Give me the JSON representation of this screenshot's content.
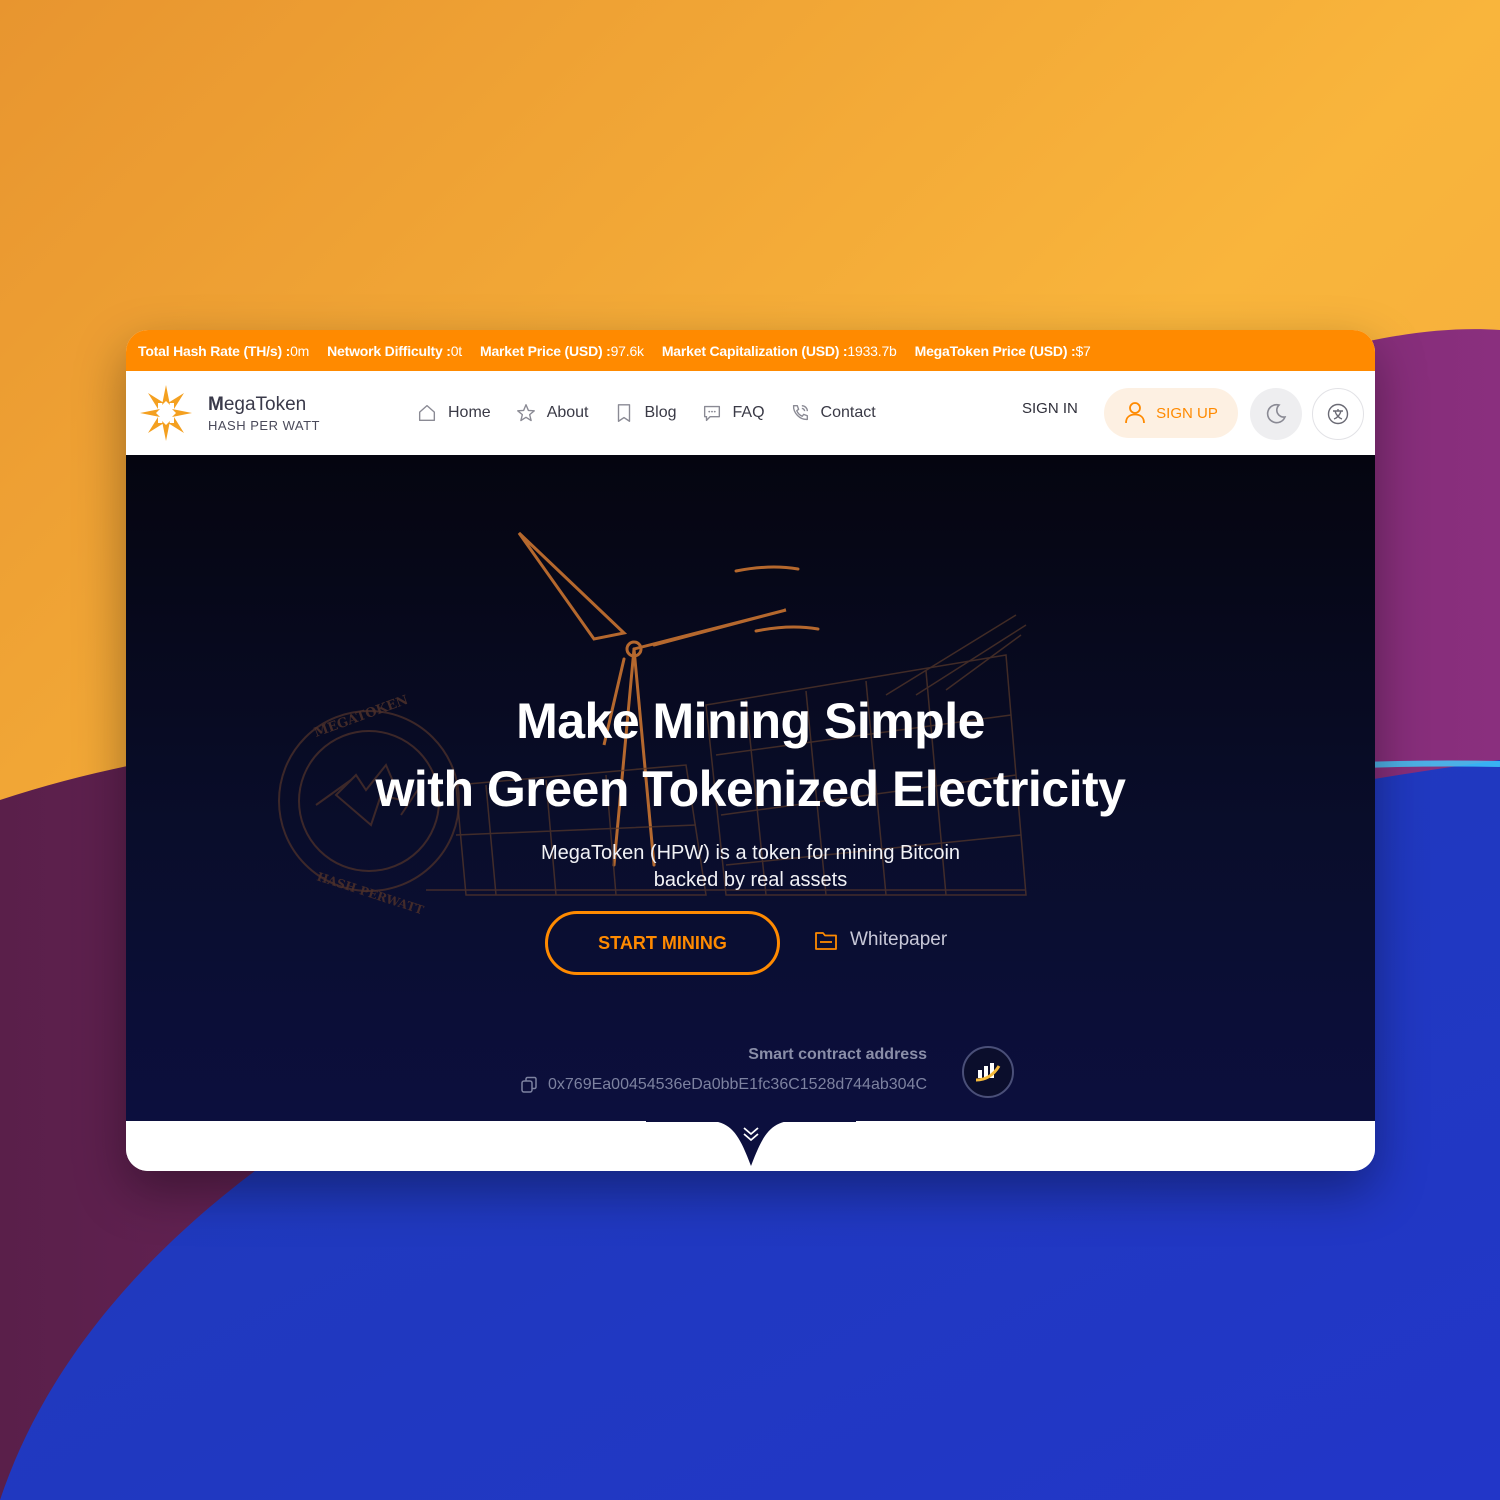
{
  "ticker": [
    {
      "label": "Total Hash Rate (TH/s) :",
      "value": "0m"
    },
    {
      "label": "Network Difficulty :",
      "value": "0t"
    },
    {
      "label": "Market Price (USD) :",
      "value": "97.6k"
    },
    {
      "label": "Market Capitalization (USD) :",
      "value": "1933.7b"
    },
    {
      "label": "MegaToken Price (USD) :",
      "value": "$7"
    }
  ],
  "brand": {
    "name_initial": "M",
    "name_rest": "egaToken",
    "subtitle": "HASH PER WATT"
  },
  "nav": {
    "home": "Home",
    "about": "About",
    "blog": "Blog",
    "faq": "FAQ",
    "contact": "Contact",
    "sign_in": "SIGN IN",
    "sign_up": "SIGN UP"
  },
  "hero": {
    "headline_line1": "Make Mining Simple",
    "headline_line2": "with Green Tokenized Electricity",
    "sub_line1": "MegaToken (HPW) is a token for mining Bitcoin",
    "sub_line2": "backed by real assets",
    "start_button": "START MINING",
    "whitepaper": "Whitepaper",
    "contract_label": "Smart contract address",
    "contract_address": "0x769Ea00454536eDa0bbE1fc36C1528d744ab304C"
  },
  "colors": {
    "accent": "#ff8a00",
    "hero_bg": "#090d2a",
    "ticker_bg": "#ff8a00"
  }
}
